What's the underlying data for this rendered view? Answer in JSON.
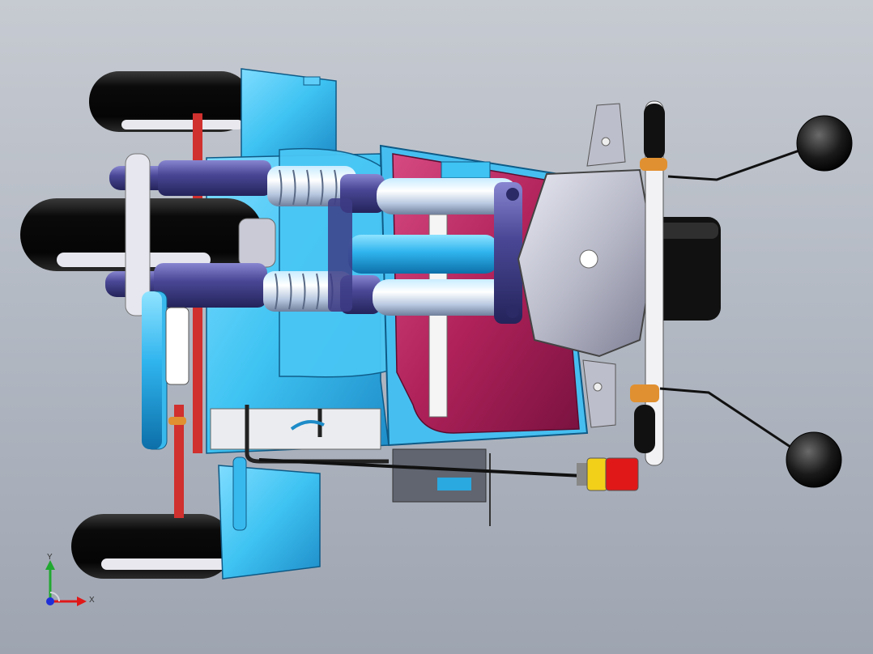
{
  "viewport": {
    "background_top": "#c6cad1",
    "background_bottom": "#9ea5b1"
  },
  "model": {
    "description_colors": {
      "body_blue": "#3ec3f2",
      "body_blue_dark": "#1e8cc8",
      "seat_magenta": "#b0225a",
      "tire_black": "#101010",
      "fork_purple": "#3d3c86",
      "headlight_grey": "#c8c9d4",
      "frame_red": "#d0302e",
      "tail_light_red": "#e01818",
      "tail_light_yellow": "#f2d01a",
      "grip_orange": "#e09030"
    }
  },
  "triad": {
    "x_label": "X",
    "y_label": "Y",
    "x_color": "#e01818",
    "y_color": "#21a830",
    "origin_color": "#1f2fd8"
  }
}
